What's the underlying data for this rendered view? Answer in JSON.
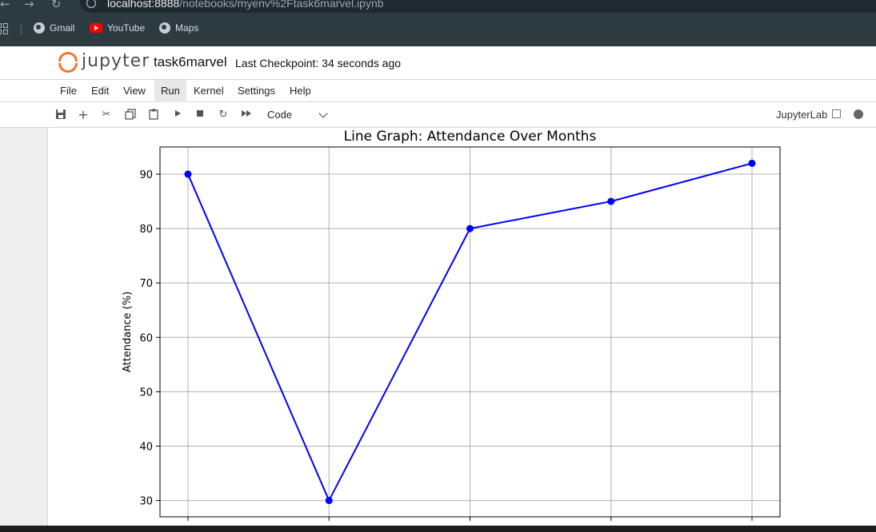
{
  "browser": {
    "url_host": "localhost:8888",
    "url_path": "/notebooks/myenv%2Ftask6marvel.ipynb",
    "bookmarks": [
      {
        "label": "Gmail",
        "icon": "globe-icon"
      },
      {
        "label": "YouTube",
        "icon": "youtube-icon"
      },
      {
        "label": "Maps",
        "icon": "globe-icon"
      }
    ]
  },
  "jupyter": {
    "logo_text": "jupyter",
    "notebook_title": "task6marvel",
    "checkpoint": "Last Checkpoint: 34 seconds ago"
  },
  "menu": {
    "items": [
      "File",
      "Edit",
      "View",
      "Run",
      "Kernel",
      "Settings",
      "Help"
    ],
    "active": "Run"
  },
  "toolbar": {
    "cell_type": "Code",
    "jupyterlab_label": "JupyterLab",
    "icons": [
      "save-icon",
      "add-cell-icon",
      "cut-icon",
      "copy-icon",
      "paste-icon",
      "run-icon",
      "stop-icon",
      "restart-icon",
      "run-all-icon"
    ]
  },
  "chart_data": {
    "type": "line",
    "title": "Line Graph: Attendance Over Months",
    "ylabel": "Attendance (%)",
    "xlabel": "",
    "x_index": [
      0,
      1,
      2,
      3,
      4
    ],
    "values": [
      90,
      30,
      80,
      85,
      92
    ],
    "ylim": [
      27,
      95
    ],
    "yticks": [
      30,
      40,
      50,
      60,
      70,
      80,
      90
    ],
    "grid": true,
    "color": "#0000ff",
    "marker": "circle"
  }
}
